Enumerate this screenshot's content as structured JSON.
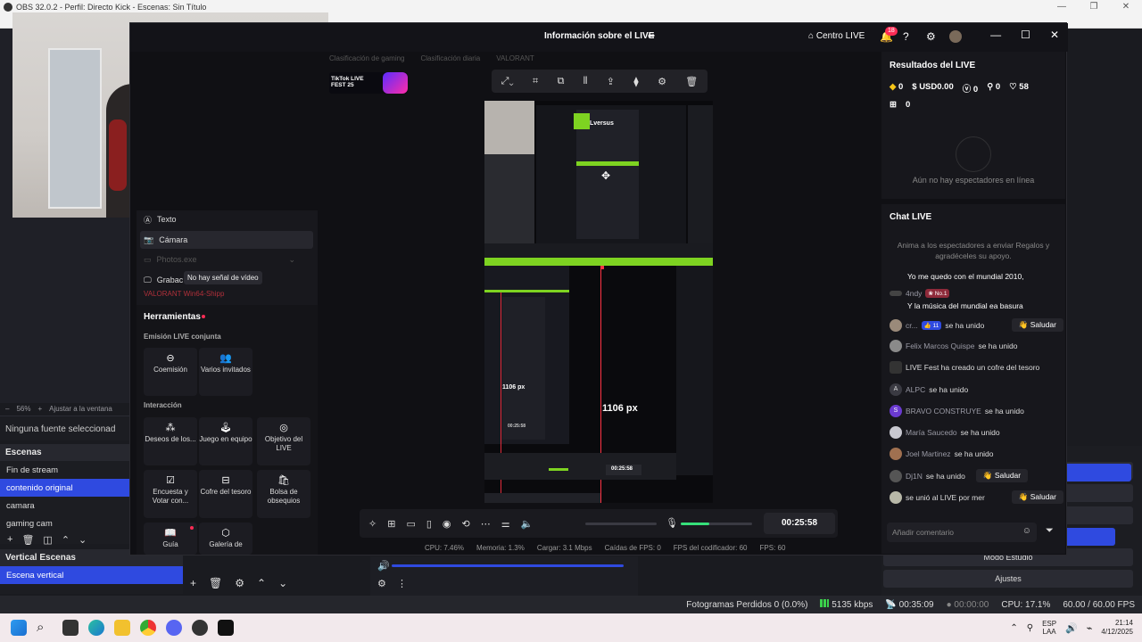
{
  "obs": {
    "title": "OBS 32.0.2 - Perfil: Directo Kick - Escenas: Sin Título",
    "zoom": "56%",
    "fit_label": "Ajustar a la ventana",
    "no_source": "Ninguna fuente seleccionad",
    "scenes_title": "Escenas",
    "scenes": [
      "Fin de stream",
      "contenido original",
      "camara",
      "gaming cam"
    ],
    "vertical_scenes_title": "Vertical Escenas",
    "vertical_scene": "Escena vertical",
    "btn_studio": "Modo Estudio",
    "btn_settings": "Ajustes",
    "status": {
      "dropped": "Fotogramas Perdidos 0 (0.0%)",
      "bitrate": "5135 kbps",
      "time1": "00:35:09",
      "time2": "00:00:00",
      "cpu": "CPU: 17.1%",
      "fps": "60.00 / 60.00 FPS"
    }
  },
  "tiktok": {
    "window_title": "Información sobre el LIVE",
    "centro_live": "Centro LIVE",
    "notif_count": "18",
    "tabs": [
      "Clasificación de gaming",
      "Clasificación diaria",
      "VALORANT"
    ],
    "fest_label": "TikTok LIVE FEST 25",
    "sources": {
      "texto": "Texto",
      "camara": "Cámara",
      "photos": "Photos.exe",
      "grabac": "Grabac",
      "tooltip": "No hay señal de vídeo",
      "valorant": "VALORANT Win64-Shipp"
    },
    "tools": {
      "title": "Herramientas",
      "section1": "Emisión LIVE conjunta",
      "coemision": "Coemisión",
      "varios": "Varios invitados",
      "section2": "Interacción",
      "deseos": "Deseos de los...",
      "juego": "Juego en equipo",
      "objetivo": "Objetivo del LIVE",
      "encuesta": "Encuesta y Votar con...",
      "cofre": "Cofre del tesoro",
      "bolsa": "Bolsa de obsequios",
      "guia": "Guía",
      "galeria": "Galería de"
    },
    "preview": {
      "px_label": "1106 px",
      "px_label_small": "1106 px",
      "inner_time": "00:25:58",
      "lversus": "Lversus"
    },
    "controls": {
      "timer": "00:25:58",
      "volume_level": 0.0,
      "mic_level": 0.4
    },
    "stats": {
      "cpu": "CPU: 7.46%",
      "memoria": "Memoria: 1.3%",
      "cargar": "Cargar: 3.1 Mbps",
      "caidas": "Caídas de FPS: 0",
      "fps_cod": "FPS del codificador: 60",
      "fps": "FPS: 60"
    },
    "results": {
      "title": "Resultados del LIVE",
      "diamonds": "0",
      "usd": "USD0.00",
      "viewers": "0",
      "followers": "0",
      "likes": "58",
      "gifts": "0",
      "empty": "Aún no hay espectadores en línea"
    },
    "chat": {
      "title": "Chat LIVE",
      "subtitle": "Anima a los espectadores a enviar Regalos y agradéceles su apoyo.",
      "msg0": "Yo me quedo con el mundial 2010,",
      "andy_user": "4ndy",
      "andy_tag": "No.1",
      "andy_msg": "Y la música del mundial ea basura",
      "cr_user": "cr...",
      "cr_tag": "11",
      "joined": "se ha unido",
      "saludar": "Saludar",
      "felix": "Felix Marcos Quispe",
      "livefest": "LIVE Fest ha creado un cofre del tesoro",
      "alpc": "ALPC",
      "bravo": "BRAVO CONSTRUYE",
      "maria": "María Saucedo",
      "joel": "Joel Martinez",
      "dj1n": "Dj1N",
      "last": "se unió al LIVE por mer",
      "placeholder": "Añadir comentario"
    }
  },
  "taskbar": {
    "lang": "ESP",
    "lang2": "LAA",
    "time": "21:14",
    "date": "4/12/2025"
  }
}
